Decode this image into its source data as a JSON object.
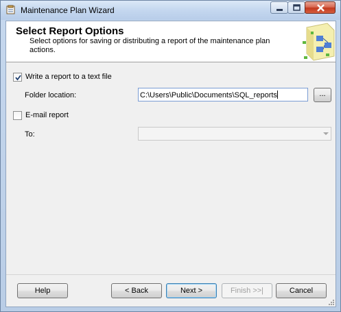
{
  "window": {
    "title": "Maintenance Plan Wizard"
  },
  "header": {
    "title": "Select Report Options",
    "subtitle": "Select options for saving or distributing a report of the maintenance plan actions."
  },
  "options": {
    "write_report": {
      "label": "Write a report to a text file",
      "checked": true
    },
    "folder_label": "Folder location:",
    "folder_value": "C:\\Users\\Public\\Documents\\SQL_reports",
    "browse_label": "...",
    "email_report": {
      "label": "E-mail report",
      "checked": false
    },
    "to_label": "To:",
    "to_value": ""
  },
  "footer": {
    "help": "Help",
    "back": "< Back",
    "next": "Next >",
    "finish": "Finish >>|",
    "cancel": "Cancel"
  },
  "colors": {
    "title_bar": "#c4d7ef",
    "close_button": "#c2391f",
    "client_background": "#f0f0f0",
    "header_background": "#ffffff",
    "disabled_text": "#a0a0a0"
  }
}
